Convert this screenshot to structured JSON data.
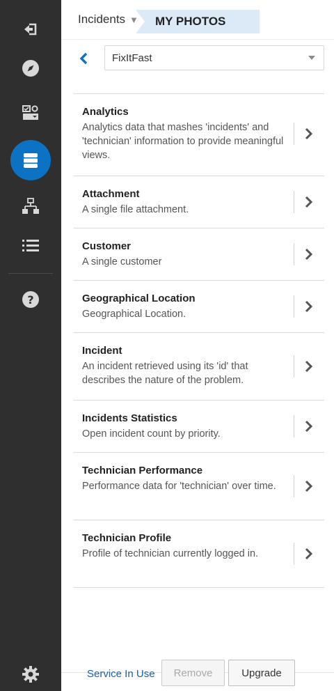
{
  "topbar": {
    "breadcrumb": "Incidents",
    "active_tab": "MY PHOTOS"
  },
  "selector": {
    "value": "FixItFast"
  },
  "items": [
    {
      "title": "Analytics",
      "desc": "Analytics data that mashes 'incidents' and 'technician' information to provide meaningful views."
    },
    {
      "title": "Attachment",
      "desc": "A single file attachment."
    },
    {
      "title": "Customer",
      "desc": "A single customer"
    },
    {
      "title": "Geographical Location",
      "desc": "Geographical Location."
    },
    {
      "title": "Incident",
      "desc": "An incident retrieved using its 'id' that describes the nature of the problem."
    },
    {
      "title": "Incidents Statistics",
      "desc": "Open incident count by priority."
    },
    {
      "title": "Technician Performance",
      "desc": "Performance data for 'technician' over time."
    },
    {
      "title": "Technician Profile",
      "desc": "Profile of technician currently logged in."
    }
  ],
  "footer": {
    "service_in_use": "Service In Use",
    "remove_label": "Remove",
    "upgrade_label": "Upgrade"
  },
  "rail": {
    "icons": [
      "exit-icon",
      "compass-icon",
      "dashboard-icon",
      "database-icon",
      "sitemap-icon",
      "list-icon",
      "help-icon",
      "gear-icon"
    ]
  },
  "colors": {
    "rail_bg": "#2f2f2f",
    "active_circle": "#0b72c4",
    "tab_bg": "#dce9f7",
    "link": "#1a5fa8",
    "back_chevron": "#0b72c4"
  }
}
